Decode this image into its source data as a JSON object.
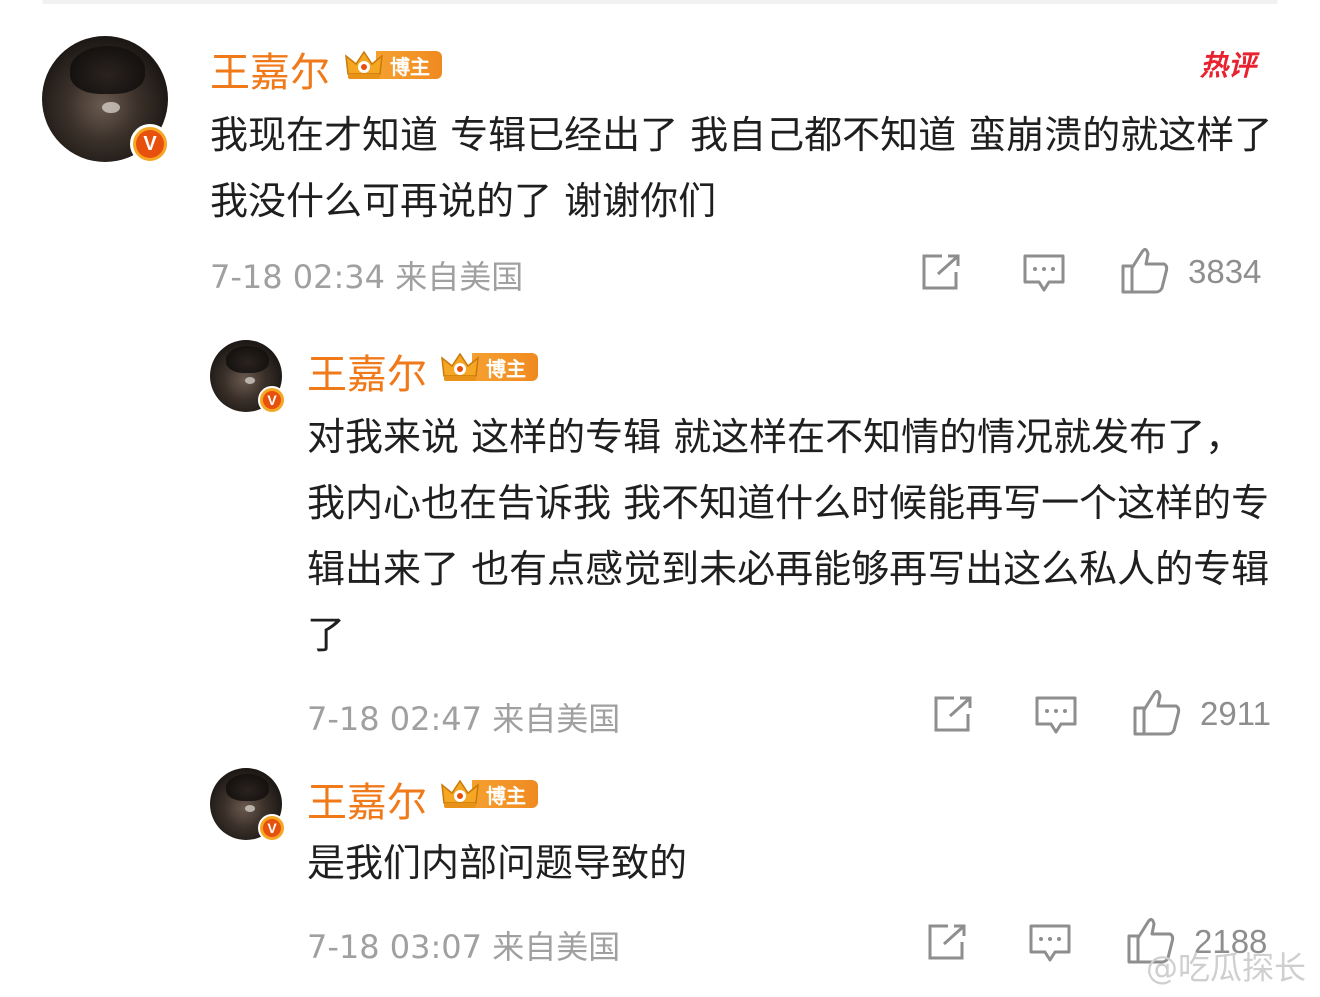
{
  "hot_label": "热评",
  "watermark": "@吃瓜探长",
  "comments": [
    {
      "user": "王嘉尔",
      "badge": "博主",
      "text": "我现在才知道 专辑已经出了 我自己都不知道 蛮崩溃的就这样了 我没什么可再说的了  谢谢你们",
      "meta": "7-18 02:34 来自美国",
      "likes": "3834"
    },
    {
      "user": "王嘉尔",
      "badge": "博主",
      "text": "对我来说 这样的专辑 就这样在不知情的情况就发布了， 我内心也在告诉我 我不知道什么时候能再写一个这样的专辑出来了 也有点感觉到未必再能够再写出这么私人的专辑了",
      "meta": "7-18 02:47 来自美国",
      "likes": "2911"
    },
    {
      "user": "王嘉尔",
      "badge": "博主",
      "text": "是我们内部问题导致的",
      "meta": "7-18 03:07 来自美国",
      "likes": "2188"
    }
  ],
  "icons": {
    "share": "share-icon",
    "comment": "comment-icon",
    "like": "thumbs-up-icon",
    "verified": "verified-v-icon",
    "crown": "crown-icon"
  },
  "colors": {
    "name": "#f07a1a",
    "badge": "#f5a030",
    "hot": "#e8232f",
    "meta": "#a0a0a0"
  }
}
